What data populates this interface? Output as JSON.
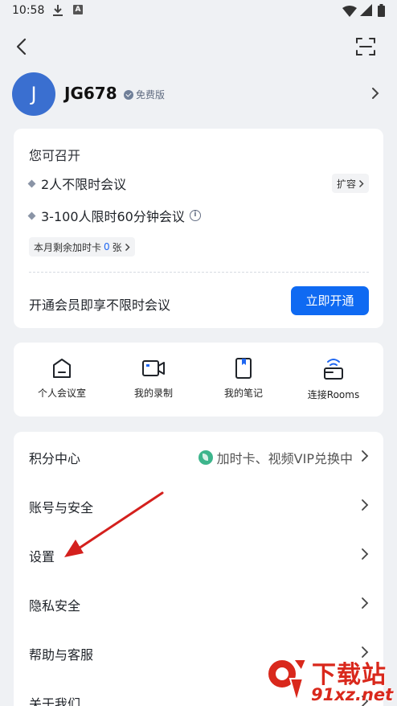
{
  "status_bar": {
    "time": "10:58"
  },
  "profile": {
    "avatar_letter": "J",
    "username": "JG678",
    "plan": "免费版"
  },
  "meeting_card": {
    "title": "您可召开",
    "items": [
      {
        "text": "2人不限时会议"
      },
      {
        "text": "3-100人限时60分钟会议"
      }
    ],
    "expand_label": "扩容",
    "chip_prefix": "本月剩余加时卡",
    "chip_count": "0",
    "chip_suffix": "张",
    "promo_text": "开通会员即享不限时会议",
    "open_button": "立即开通"
  },
  "tools": [
    {
      "label": "个人会议室",
      "icon": "personal-room-icon"
    },
    {
      "label": "我的录制",
      "icon": "video-camera-icon"
    },
    {
      "label": "我的笔记",
      "icon": "notebook-icon"
    },
    {
      "label": "连接Rooms",
      "icon": "rooms-connect-icon"
    }
  ],
  "menu": [
    {
      "label": "积分中心",
      "extra": "加时卡、视频VIP兑换中"
    },
    {
      "label": "账号与安全"
    },
    {
      "label": "设置"
    },
    {
      "label": "隐私安全"
    },
    {
      "label": "帮助与客服"
    },
    {
      "label": "关于我们"
    }
  ],
  "watermark": {
    "title": "下载站",
    "url": "91xz.net"
  },
  "colors": {
    "accent": "#0f6af2",
    "annotation_arrow": "#d4201d",
    "watermark": "#d9281c"
  }
}
